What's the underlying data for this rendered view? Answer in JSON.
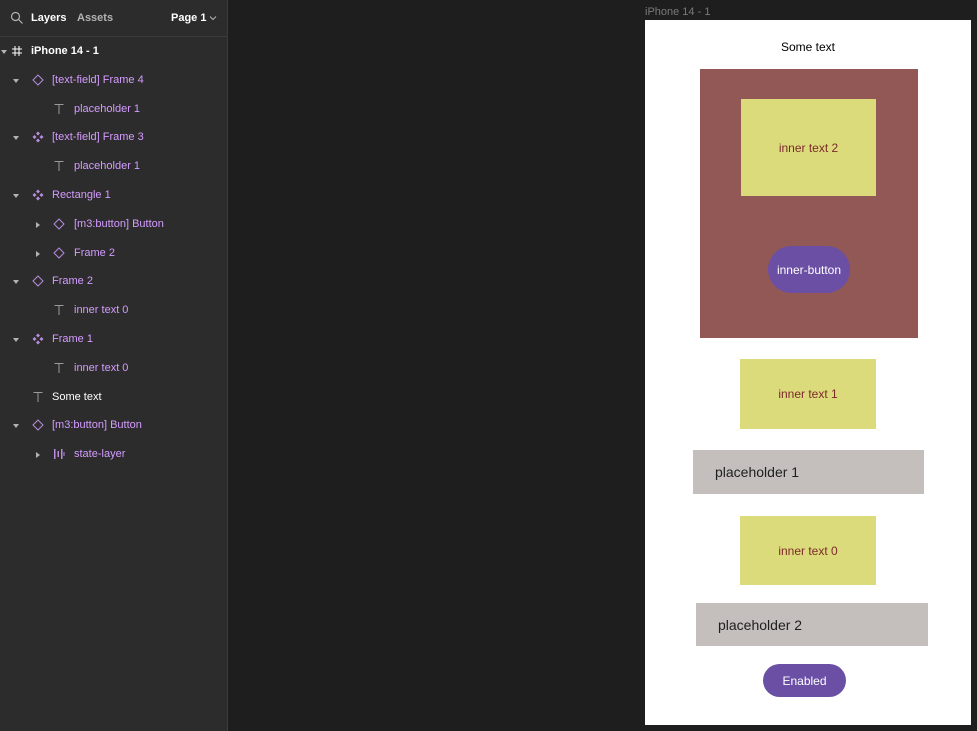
{
  "panel": {
    "tabs": {
      "layers": "Layers",
      "assets": "Assets"
    },
    "page": "Page 1",
    "layers": [
      {
        "label": "iPhone 14 - 1",
        "icon": "frame-hash-icon",
        "color": "#ffffff"
      },
      {
        "label": "[text-field] Frame 4",
        "icon": "component-instance-icon",
        "color": "#d49cff"
      },
      {
        "label": "placeholder 1",
        "icon": "text-icon",
        "color": "#d49cff"
      },
      {
        "label": "[text-field] Frame 3",
        "icon": "component-icon",
        "color": "#d49cff"
      },
      {
        "label": "placeholder 1",
        "icon": "text-icon",
        "color": "#d49cff"
      },
      {
        "label": "Rectangle 1",
        "icon": "component-icon",
        "color": "#d49cff"
      },
      {
        "label": "[m3:button] Button",
        "icon": "component-instance-icon",
        "color": "#d49cff"
      },
      {
        "label": "Frame 2",
        "icon": "component-instance-icon",
        "color": "#d49cff"
      },
      {
        "label": "Frame 2",
        "icon": "component-instance-icon",
        "color": "#d49cff"
      },
      {
        "label": "inner text 0",
        "icon": "text-icon",
        "color": "#d49cff"
      },
      {
        "label": "Frame 1",
        "icon": "component-icon",
        "color": "#d49cff"
      },
      {
        "label": "inner text 0",
        "icon": "text-icon",
        "color": "#d49cff"
      },
      {
        "label": "Some text",
        "icon": "text-icon",
        "color": "#ffffff"
      },
      {
        "label": "[m3:button] Button",
        "icon": "component-instance-icon",
        "color": "#d49cff"
      },
      {
        "label": "state-layer",
        "icon": "auto-layout-icon",
        "color": "#d49cff"
      }
    ]
  },
  "canvas": {
    "frame_title": "iPhone 14 - 1",
    "some_text": "Some text",
    "inner_text_2": "inner text 2",
    "inner_button": "inner-button",
    "inner_text_1": "inner text 1",
    "placeholder_1": "placeholder 1",
    "inner_text_0": "inner text 0",
    "placeholder_2": "placeholder 2",
    "enabled_button": "Enabled"
  },
  "colors": {
    "panel_bg": "#2c2c2c",
    "canvas_bg": "#1e1e1e",
    "component_text": "#d49cff",
    "rectangle_fill": "#925856",
    "yellow_box": "#dcdb7c",
    "button_purple": "#6b4fa5",
    "field_gray": "#c4bfbd"
  }
}
